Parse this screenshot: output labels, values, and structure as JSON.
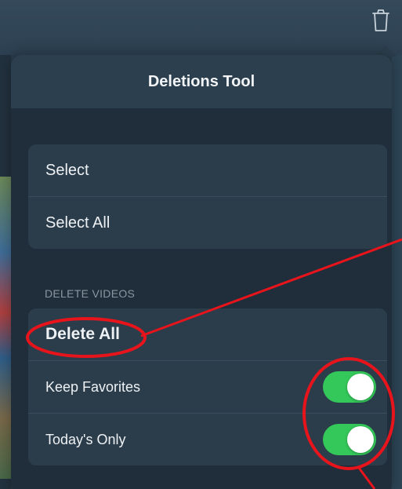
{
  "popover": {
    "title": "Deletions Tool"
  },
  "select_group": {
    "items": [
      {
        "label": "Select"
      },
      {
        "label": "Select All"
      }
    ]
  },
  "delete_videos": {
    "section_label": "DELETE VIDEOS",
    "delete_all_label": "Delete All",
    "keep_favorites_label": "Keep Favorites",
    "keep_favorites_on": true,
    "todays_only_label": "Today's Only",
    "todays_only_on": true
  },
  "colors": {
    "toggle_on": "#34c759",
    "annotation": "#e8141c",
    "popover_bg": "#1f2e3a",
    "header_bg": "#2c3f4e"
  },
  "icons": {
    "trash": "trash-icon"
  }
}
